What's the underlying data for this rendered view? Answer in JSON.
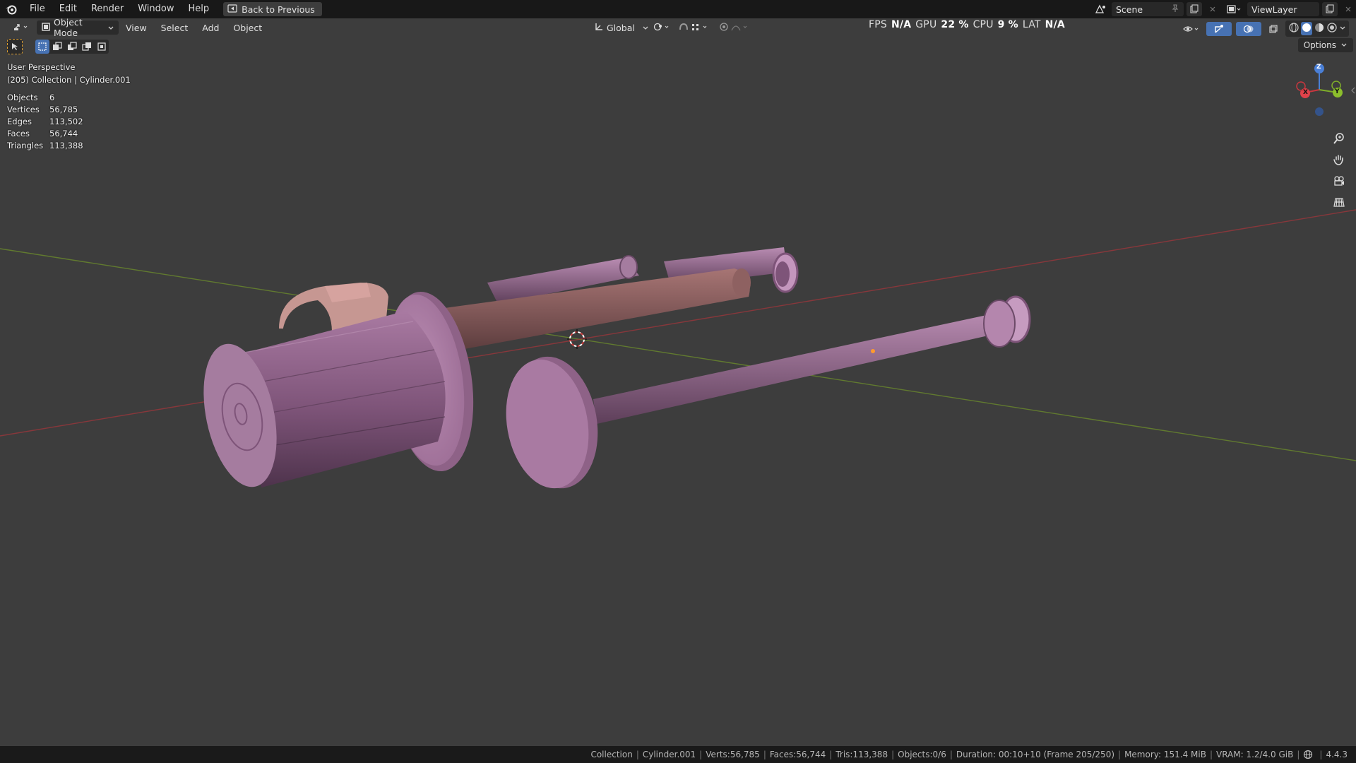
{
  "topbar": {
    "menus": [
      "File",
      "Edit",
      "Render",
      "Window",
      "Help"
    ],
    "back_button": "Back to Previous",
    "scene": "Scene",
    "view_layer": "ViewLayer"
  },
  "viewport_header": {
    "mode": "Object Mode",
    "menus": [
      "View",
      "Select",
      "Add",
      "Object"
    ],
    "orientation": "Global",
    "options": "Options"
  },
  "perf": {
    "fps_label": "FPS",
    "fps_value": "N/A",
    "gpu_label": "GPU",
    "gpu_value": "22 %",
    "cpu_label": "CPU",
    "cpu_value": "9 %",
    "lat_label": "LAT",
    "lat_value": "N/A"
  },
  "overlay": {
    "view_name": "User Perspective",
    "context": "(205) Collection | Cylinder.001",
    "stats": [
      {
        "label": "Objects",
        "value": "6"
      },
      {
        "label": "Vertices",
        "value": "56,785"
      },
      {
        "label": "Edges",
        "value": "113,502"
      },
      {
        "label": "Faces",
        "value": "56,744"
      },
      {
        "label": "Triangles",
        "value": "113,388"
      }
    ]
  },
  "gizmo": {
    "x": "X",
    "y": "Y",
    "z": "Z"
  },
  "statusbar": {
    "collection": "Collection",
    "object": "Cylinder.001",
    "verts": "Verts:56,785",
    "faces": "Faces:56,744",
    "tris": "Tris:113,388",
    "objects": "Objects:0/6",
    "duration": "Duration: 00:10+10 (Frame 205/250)",
    "memory": "Memory: 151.4 MiB",
    "vram": "VRAM: 1.2/4.0 GiB",
    "version": "4.4.3"
  },
  "colors": {
    "accent": "#4772b3",
    "mesh_pink": "#b07aa7",
    "mesh_brown": "#8a5a5c",
    "axis_x": "#a8353b",
    "axis_y": "#6b8a2c"
  },
  "icons": [
    "blender-logo",
    "back-icon",
    "scene-icon",
    "pin-icon",
    "new-scene-icon",
    "close-icon",
    "view-layer-icon",
    "editor-type-icon",
    "object-mode-icon",
    "transform-orientation-icon",
    "pivot-icon",
    "snap-icon",
    "proportional-icon",
    "visibility-icon",
    "gizmo-icon",
    "overlay-icon",
    "xray-icon",
    "shading-wire-icon",
    "shading-solid-icon",
    "shading-material-icon",
    "shading-render-icon",
    "zoom-icon",
    "pan-icon",
    "camera-icon",
    "ortho-grid-icon",
    "select-box-icon",
    "globe-icon"
  ]
}
